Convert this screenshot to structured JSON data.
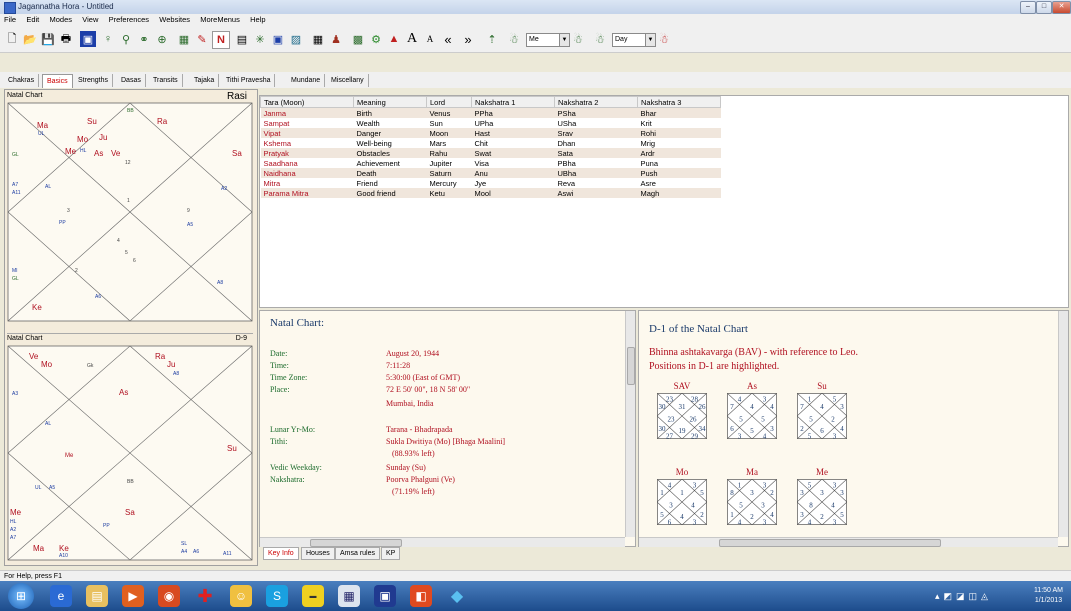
{
  "window": {
    "title": "Jagannatha Hora - Untitled"
  },
  "menu": [
    "File",
    "Edit",
    "Modes",
    "View",
    "Preferences",
    "Websites",
    "MoreMenus",
    "Help"
  ],
  "toolbar": {
    "combo1": "Me",
    "combo2": "Day",
    "font_big": "A",
    "font_small": "A"
  },
  "tabs": [
    "Chakras",
    "Basics",
    "Strengths",
    "Dasas",
    "Transits",
    "Tajaka",
    "Tithi Pravesha",
    "Mundane",
    "Miscellany"
  ],
  "active_tab": "Basics",
  "rasi_chart": {
    "header_left": "Natal Chart",
    "header_right": "Rasi",
    "planets": {
      "ma": "Ma",
      "ul": "UL",
      "su": "Su",
      "ra": "Ra",
      "mo": "Mo",
      "ju": "Ju",
      "me": "Me",
      "hl": "HL",
      "as": "As",
      "ve": "Ve",
      "sa": "Sa",
      "ke": "Ke",
      "gk": "GL",
      "al": "AL",
      "bb": "BB",
      "a7": "A7",
      "a11": "A11",
      "ppp": "PP",
      "mi": "MI",
      "ga": "GL",
      "a2": "A2",
      "a5": "A5",
      "a6": "A6",
      "a8": "A8"
    },
    "nums": {
      "n12": "12",
      "n1": "1",
      "n2": "2",
      "n3": "3",
      "n4": "4",
      "n5": "5",
      "n6": "6",
      "n7": "7",
      "n8": "8",
      "n9": "9",
      "n10": "10",
      "n11": "11"
    }
  },
  "d9_chart": {
    "header_left": "Natal Chart",
    "header_right": "D-9",
    "planets": {
      "ve": "Ve",
      "mo": "Mo",
      "gk": "Gk",
      "ra": "Ra",
      "ju": "Ju",
      "a8": "A8",
      "as": "As",
      "al": "AL",
      "a3": "A3",
      "me": "Me",
      "su": "Su",
      "bb": "BB",
      "ul": "UL",
      "a5": "A5",
      "sa": "Sa",
      "mel": "Me",
      "hl": "HL",
      "a2": "A2",
      "a7": "A7",
      "ma": "Ma",
      "ke": "Ke",
      "a10": "A10",
      "pp": "PP",
      "sl": "SL",
      "a4": "A4",
      "a6": "A6",
      "a11": "A11"
    }
  },
  "tara_table": {
    "headers": [
      "Tara (Moon)",
      "Meaning",
      "Lord",
      "Nakshatra 1",
      "Nakshatra 2",
      "Nakshatra 3"
    ],
    "rows": [
      [
        "Janma",
        "Birth",
        "Venus",
        "PPha",
        "PSha",
        "Bhar"
      ],
      [
        "Sampat",
        "Wealth",
        "Sun",
        "UPha",
        "USha",
        "Krit"
      ],
      [
        "Vipat",
        "Danger",
        "Moon",
        "Hast",
        "Srav",
        "Rohi"
      ],
      [
        "Kshema",
        "Well-being",
        "Mars",
        "Chit",
        "Dhan",
        "Mrig"
      ],
      [
        "Pratyak",
        "Obstacles",
        "Rahu",
        "Swat",
        "Sata",
        "Ardr"
      ],
      [
        "Saadhana",
        "Achievement",
        "Jupiter",
        "Visa",
        "PBha",
        "Puna"
      ],
      [
        "Naidhana",
        "Death",
        "Saturn",
        "Anu",
        "UBha",
        "Push"
      ],
      [
        "Mitra",
        "Friend",
        "Mercury",
        "Jye",
        "Reva",
        "Asre"
      ],
      [
        "Parama Mitra",
        "Good friend",
        "Ketu",
        "Mool",
        "Aswi",
        "Magh"
      ]
    ]
  },
  "key_info": {
    "title": "Natal Chart:",
    "items": [
      {
        "label": "Date:",
        "value": "August 20, 1944"
      },
      {
        "label": "Time:",
        "value": "7:11:28"
      },
      {
        "label": "Time Zone:",
        "value": "5:30:00 (East of GMT)"
      },
      {
        "label": "Place:",
        "value": "72 E 50' 00\", 18 N 58' 00\""
      },
      {
        "label": "",
        "value": "Mumbai, India"
      },
      {
        "label": "Lunar Yr-Mo:",
        "value": "Tarana - Bhadrapada"
      },
      {
        "label": "Tithi:",
        "value": "Sukla Dwitiya (Mo) [Bhaga Maalini]"
      },
      {
        "label": "",
        "value": "(88.93% left)"
      },
      {
        "label": "Vedic Weekday:",
        "value": "Sunday (Su)"
      },
      {
        "label": "Nakshatra:",
        "value": "Poorva Phalguni (Ve)"
      },
      {
        "label": "",
        "value": "(71.19% left)"
      }
    ]
  },
  "bav": {
    "title": "D-1 of the Natal Chart",
    "line1": "Bhinna ashtakavarga (BAV) - with reference to Leo.",
    "line2": "Positions in D-1 are highlighted.",
    "charts": [
      {
        "label": "SAV",
        "nums": [
          "31",
          "23",
          "30",
          "23",
          "30",
          "27",
          "19",
          "29",
          "34",
          "26",
          "26",
          "28"
        ]
      },
      {
        "label": "As",
        "nums": [
          "4",
          "4",
          "7",
          "5",
          "6",
          "3",
          "5",
          "4",
          "3",
          "5",
          "4",
          "3"
        ]
      },
      {
        "label": "Su",
        "nums": [
          "4",
          "1",
          "7",
          "5",
          "2",
          "5",
          "6",
          "3",
          "4",
          "2",
          "3",
          "5"
        ]
      },
      {
        "label": "Mo",
        "nums": [
          "1",
          "4",
          "1",
          "3",
          "5",
          "6",
          "4",
          "3",
          "2",
          "4",
          "5",
          "3"
        ]
      },
      {
        "label": "Ma",
        "nums": [
          "3",
          "1",
          "8",
          "5",
          "1",
          "4",
          "2",
          "3",
          "4",
          "3",
          "2",
          "3"
        ]
      },
      {
        "label": "Me",
        "nums": [
          "3",
          "5",
          "3",
          "8",
          "3",
          "4",
          "2",
          "3",
          "5",
          "4",
          "3",
          "3"
        ]
      }
    ]
  },
  "bottom_tabs": [
    "Key Info",
    "Houses",
    "Amsa rules",
    "KP"
  ],
  "active_bottom_tab": "Key Info",
  "status": "For Help, press F1",
  "clock": {
    "time": "11:50 AM",
    "date": "1/1/2013"
  }
}
